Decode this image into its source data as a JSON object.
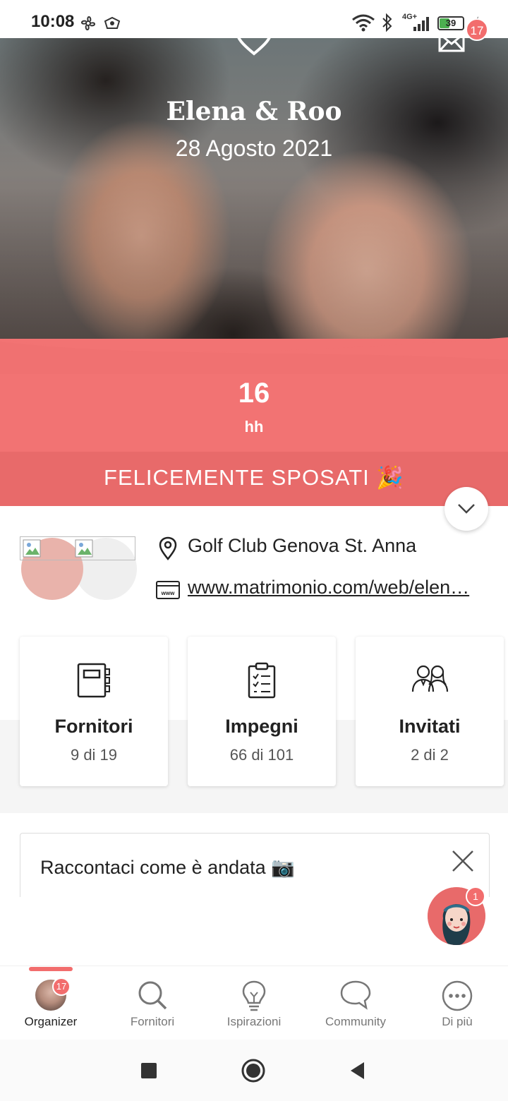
{
  "status_bar": {
    "time": "10:08",
    "battery": "39",
    "network": "4G+"
  },
  "header": {
    "couple_names": "Elena & Roo",
    "date": "28 Agosto 2021",
    "mail_badge": "17"
  },
  "countdown": {
    "value": "16",
    "unit": "hh"
  },
  "married_banner": "FELICEMENTE SPOSATI 🎉",
  "details": {
    "location": "Golf Club Genova St. Anna",
    "website": "www.matrimonio.com/web/elen…"
  },
  "stats": [
    {
      "title": "Fornitori",
      "value": "9 di 19",
      "icon": "notebook-icon"
    },
    {
      "title": "Impegni",
      "value": "66 di 101",
      "icon": "checklist-icon"
    },
    {
      "title": "Invitati",
      "value": "2 di 2",
      "icon": "guests-icon"
    }
  ],
  "story_card": {
    "title": "Raccontaci come è andata 📷"
  },
  "assistant": {
    "badge": "1"
  },
  "bottom_nav": {
    "items": [
      {
        "label": "Organizer",
        "badge": "17"
      },
      {
        "label": "Fornitori"
      },
      {
        "label": "Ispirazioni"
      },
      {
        "label": "Community"
      },
      {
        "label": "Di più"
      }
    ]
  },
  "colors": {
    "accent": "#f27373",
    "accent_dark": "#e86a6a"
  }
}
